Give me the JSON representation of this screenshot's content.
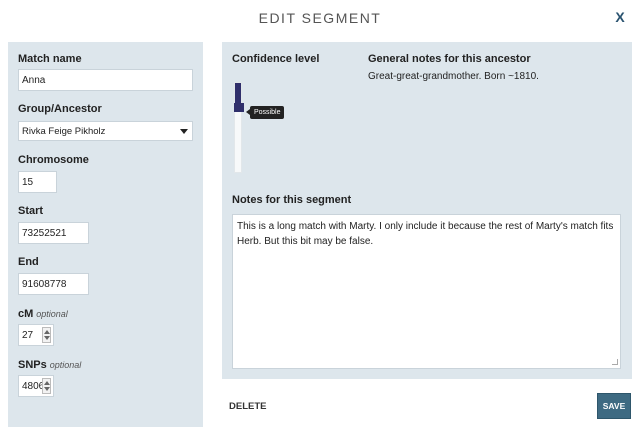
{
  "dialog": {
    "title": "EDIT SEGMENT",
    "close_label": "X"
  },
  "form": {
    "match_name": {
      "label": "Match name",
      "value": "Anna"
    },
    "group": {
      "label": "Group/Ancestor",
      "value": "Rivka Feige Pikholz"
    },
    "chromosome": {
      "label": "Chromosome",
      "value": "15"
    },
    "start": {
      "label": "Start",
      "value": "73252521"
    },
    "end": {
      "label": "End",
      "value": "91608778"
    },
    "cm": {
      "label": "cM",
      "optional": "optional",
      "value": "27"
    },
    "snps": {
      "label": "SNPs",
      "optional": "optional",
      "value": "4806"
    }
  },
  "confidence": {
    "label": "Confidence level",
    "tooltip": "Possible",
    "level_fraction": 0.3
  },
  "general_notes": {
    "label": "General notes for this ancestor",
    "text": "Great-great-grandmother. Born ~1810."
  },
  "segment_notes": {
    "label": "Notes for this segment",
    "text": "This is a long match with Marty. I only include it because the rest of Marty's match fits Herb. But this bit may be false."
  },
  "actions": {
    "delete_label": "DELETE",
    "save_label": "SAVE"
  },
  "colors": {
    "panel_bg": "#dde6ec",
    "slider": "#2f2f6b",
    "save_button": "#3e6a82"
  }
}
